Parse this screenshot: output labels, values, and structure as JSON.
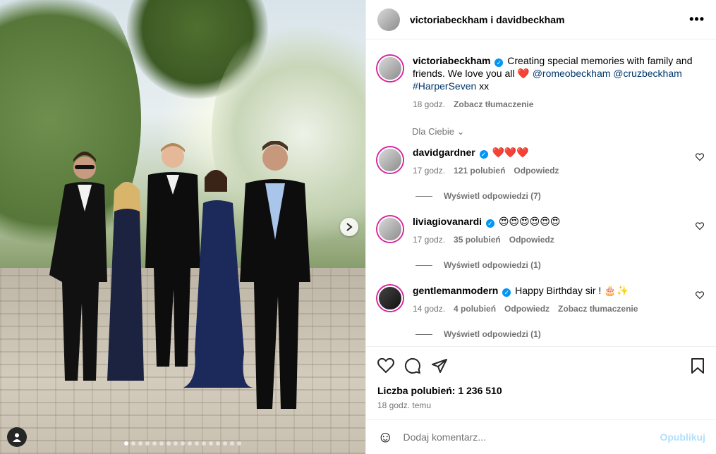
{
  "header": {
    "names": "victoriabeckham i davidbeckham",
    "more": "•••"
  },
  "caption": {
    "user": "victoriabeckham",
    "text": "Creating special memories with family and friends. We love you all",
    "heart": "❤️",
    "mention1": "@romeobeckham",
    "mention2": "@cruzbeckham",
    "hashtag": "#HarperSeven",
    "tail": "xx",
    "time": "18 godz.",
    "translate": "Zobacz tłumaczenie"
  },
  "filter": {
    "label": "Dla Ciebie"
  },
  "comments": [
    {
      "user": "davidgardner",
      "text": "❤️❤️❤️",
      "time": "17 godz.",
      "likes": "121 polubień",
      "reply": "Odpowiedz",
      "replies": "Wyświetl odpowiedzi (7)"
    },
    {
      "user": "liviagiovanardi",
      "text": "😍😍😍😍😍😍",
      "time": "17 godz.",
      "likes": "35 polubień",
      "reply": "Odpowiedz",
      "replies": "Wyświetl odpowiedzi (1)"
    },
    {
      "user": "gentlemanmodern",
      "text": "Happy Birthday sir ! 🎂✨",
      "time": "14 godz.",
      "likes": "4 polubień",
      "reply": "Odpowiedz",
      "translate": "Zobacz tłumaczenie",
      "replies": "Wyświetl odpowiedzi (1)"
    }
  ],
  "actions": {
    "likes": "Liczba polubień: 1 236 510",
    "posted": "18 godz. temu"
  },
  "composer": {
    "emoji": "☺",
    "placeholder": "Dodaj komentarz...",
    "publish": "Opublikuj"
  },
  "colors": {
    "link": "#00376b",
    "muted": "#737373",
    "verified": "#0095f6",
    "publish": "#b2dffc"
  },
  "icons": [
    "heart-icon",
    "comment-icon",
    "share-icon",
    "save-icon",
    "emoji-icon",
    "chevron-right-icon",
    "user-tag-icon",
    "more-icon"
  ]
}
